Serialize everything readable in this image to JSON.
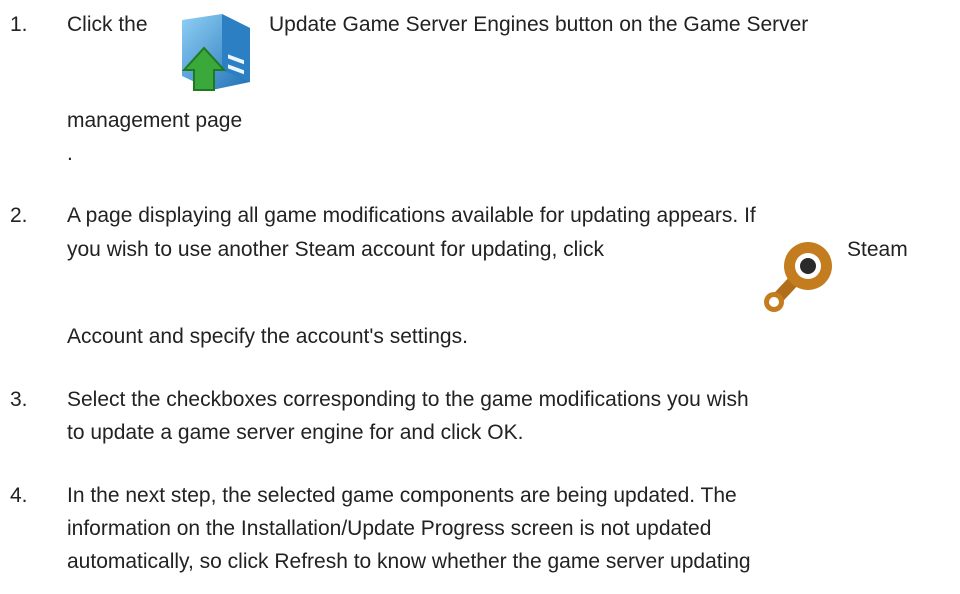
{
  "steps": [
    {
      "number": "1.",
      "text_before": "Click the",
      "icon": "update-server-icon",
      "text_after": "Update Game Server Engines button on the Game Server",
      "line2": "management page",
      "line3": "."
    },
    {
      "number": "2.",
      "line1": "A page displaying all game modifications available for updating appears. If",
      "line2_before": "you wish to use another Steam account for updating, click",
      "icon": "steam-icon",
      "line2_after": "Steam",
      "line3": "Account and specify the account's settings."
    },
    {
      "number": "3.",
      "line1": "Select the checkboxes corresponding to the game modifications you wish",
      "line2": "to update a game server engine for and click OK."
    },
    {
      "number": "4.",
      "line1": "In the next step, the selected game components are being updated. The",
      "line2": "information on the Installation/Update Progress screen is not updated",
      "line3": "automatically, so click Refresh to know whether the game server updating"
    }
  ],
  "colors": {
    "text": "#222222",
    "server_blue": "#3a8fd0",
    "arrow_green": "#3aa83a",
    "steam_orange": "#c0781a"
  }
}
